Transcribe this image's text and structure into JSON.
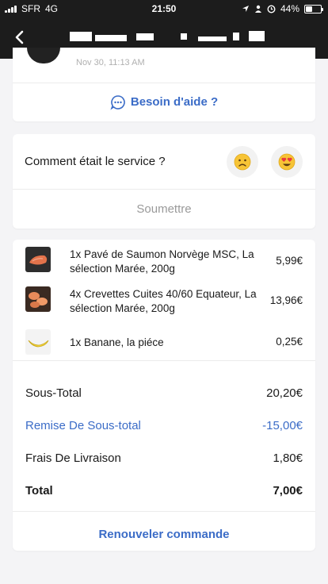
{
  "status_bar": {
    "carrier": "SFR",
    "network": "4G",
    "time": "21:50",
    "battery": "44%",
    "battery_level": 0.44,
    "icons": [
      "location-icon",
      "person-icon",
      "alarm-icon"
    ]
  },
  "nav": {
    "back_icon": "chevron-left-icon"
  },
  "order": {
    "date": "Nov 30, 11:13 AM"
  },
  "help": {
    "label": "Besoin d'aide ?",
    "icon": "chat-bubble-icon",
    "color": "#3b6cc7"
  },
  "rating": {
    "question": "Comment était le service ?",
    "options": [
      {
        "name": "sad-face",
        "emoji": "🙁"
      },
      {
        "name": "heart-eyes-face",
        "emoji": "😍"
      }
    ],
    "submit_label": "Soumettre"
  },
  "items": [
    {
      "qty_name": "1x Pavé de Saumon Norvège MSC, La sélection Marée, 200g",
      "price": "5,99€",
      "thumb": "salmon"
    },
    {
      "qty_name": "4x Crevettes Cuites 40/60 Equateur, La sélection Marée, 200g",
      "price": "13,96€",
      "thumb": "shrimp"
    },
    {
      "qty_name": "1x Banane, la piéce",
      "price": "0,25€",
      "thumb": "banana"
    }
  ],
  "summary": {
    "subtotal_label": "Sous-Total",
    "subtotal_value": "20,20€",
    "discount_label": "Remise De Sous-total",
    "discount_value": "-15,00€",
    "delivery_label": "Frais De Livraison",
    "delivery_value": "1,80€",
    "total_label": "Total",
    "total_value": "7,00€"
  },
  "renew_label": "Renouveler commande",
  "colors": {
    "accent": "#3b6cc7",
    "header_bg": "#1c1c1c",
    "page_bg": "#f4f4f6"
  }
}
